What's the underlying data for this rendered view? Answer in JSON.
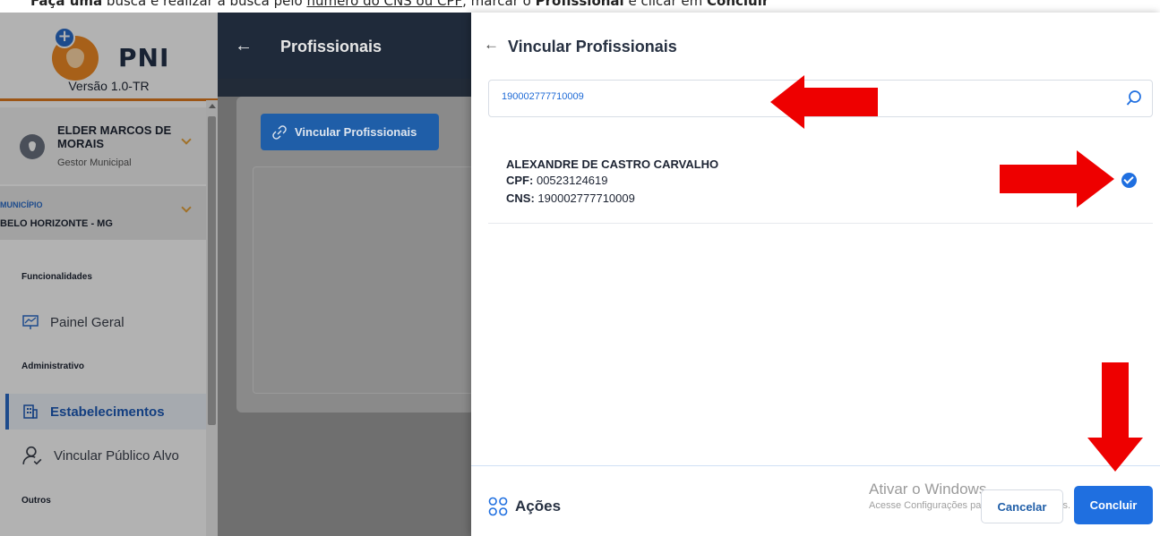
{
  "instruction": {
    "prefix_bold": "Faça uma",
    "part1": " busca e realizar a busca pelo ",
    "underlined": "número do CNS ou CPF",
    "part2": ", marcar o ",
    "bold2": "Profissional",
    "part3": " e clicar em ",
    "bold3": "Concluir"
  },
  "sidebar": {
    "logo_text": "PNI",
    "version": "Versão 1.0-TR",
    "user": {
      "name": "ELDER MARCOS DE MORAIS",
      "role": "Gestor Municipal"
    },
    "municipio": {
      "label": "MUNICÍPIO",
      "value": "BELO HORIZONTE - MG"
    },
    "sections": [
      {
        "title": "Funcionalidades"
      },
      {
        "title": "Administrativo"
      },
      {
        "title": "Outros"
      }
    ],
    "items": [
      {
        "label": "Painel Geral",
        "icon": "presentation-board-icon"
      },
      {
        "label": "Estabelecimentos",
        "icon": "building-icon"
      },
      {
        "label": "Vincular Público Alvo",
        "icon": "user-check-icon"
      }
    ]
  },
  "main": {
    "title": "Profissionais",
    "vincular_button": "Vincular Profissionais"
  },
  "panel": {
    "title": "Vincular Profissionais",
    "search": {
      "value": "190002777710009",
      "placeholder": ""
    },
    "result": {
      "name": "ALEXANDRE DE CASTRO CARVALHO",
      "cpf_label": "CPF:",
      "cpf": "00523124619",
      "cns_label": "CNS:",
      "cns": "190002777710009",
      "checked": true
    },
    "footer": {
      "actions_label": "Ações",
      "cancel_label": "Cancelar",
      "confirm_label": "Concluir"
    }
  },
  "watermark": {
    "line1": "Ativar o Windows",
    "line2": "Acesse Configurações para ativar o Windows."
  },
  "colors": {
    "accent": "#1f6fe0",
    "annotation_red": "#ee0000",
    "brand_orange": "#e07a1f",
    "topbar": "#1f2a3a"
  }
}
